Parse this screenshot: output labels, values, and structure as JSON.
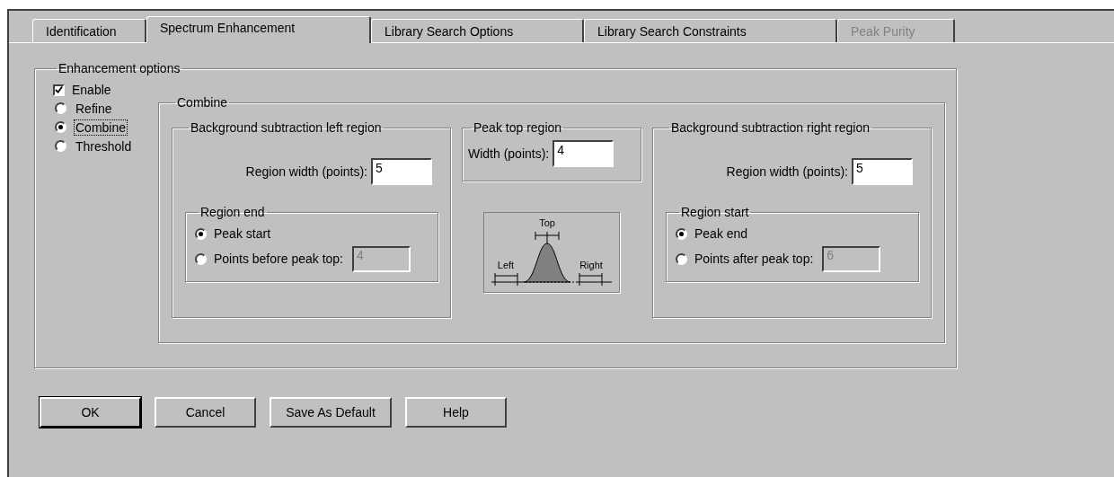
{
  "tabs": [
    {
      "label": "Identification",
      "selected": false,
      "disabled": false
    },
    {
      "label": "Spectrum Enhancement",
      "selected": true,
      "disabled": false
    },
    {
      "label": "Library Search Options",
      "selected": false,
      "disabled": false
    },
    {
      "label": "Library Search Constraints",
      "selected": false,
      "disabled": false
    },
    {
      "label": "Peak Purity",
      "selected": false,
      "disabled": true
    }
  ],
  "enhancement_options": {
    "title": "Enhancement options",
    "enable": {
      "label": "Enable",
      "checked": true
    },
    "modes": [
      {
        "label": "Refine",
        "selected": false,
        "focused": false
      },
      {
        "label": "Combine",
        "selected": true,
        "focused": true
      },
      {
        "label": "Threshold",
        "selected": false,
        "focused": false
      }
    ],
    "combine": {
      "title": "Combine",
      "left_region": {
        "title": "Background subtraction left region",
        "width_label": "Region width (points):",
        "width_value": "5",
        "sub_group": {
          "title": "Region end",
          "options": [
            {
              "label": "Peak start",
              "selected": true
            },
            {
              "label": "Points before peak top:",
              "selected": false
            }
          ],
          "points_value": "4",
          "points_disabled": true
        }
      },
      "peak_top": {
        "title": "Peak top region",
        "width_label": "Width (points):",
        "width_value": "4"
      },
      "diagram": {
        "top": "Top",
        "left": "Left",
        "right": "Right"
      },
      "right_region": {
        "title": "Background subtraction right region",
        "width_label": "Region width (points):",
        "width_value": "5",
        "sub_group": {
          "title": "Region start",
          "options": [
            {
              "label": "Peak end",
              "selected": true
            },
            {
              "label": "Points after peak top:",
              "selected": false
            }
          ],
          "points_value": "6",
          "points_disabled": true
        }
      }
    }
  },
  "buttons": [
    {
      "label": "OK",
      "default": true
    },
    {
      "label": "Cancel",
      "default": false
    },
    {
      "label": "Save As Default",
      "default": false
    },
    {
      "label": "Help",
      "default": false
    }
  ]
}
